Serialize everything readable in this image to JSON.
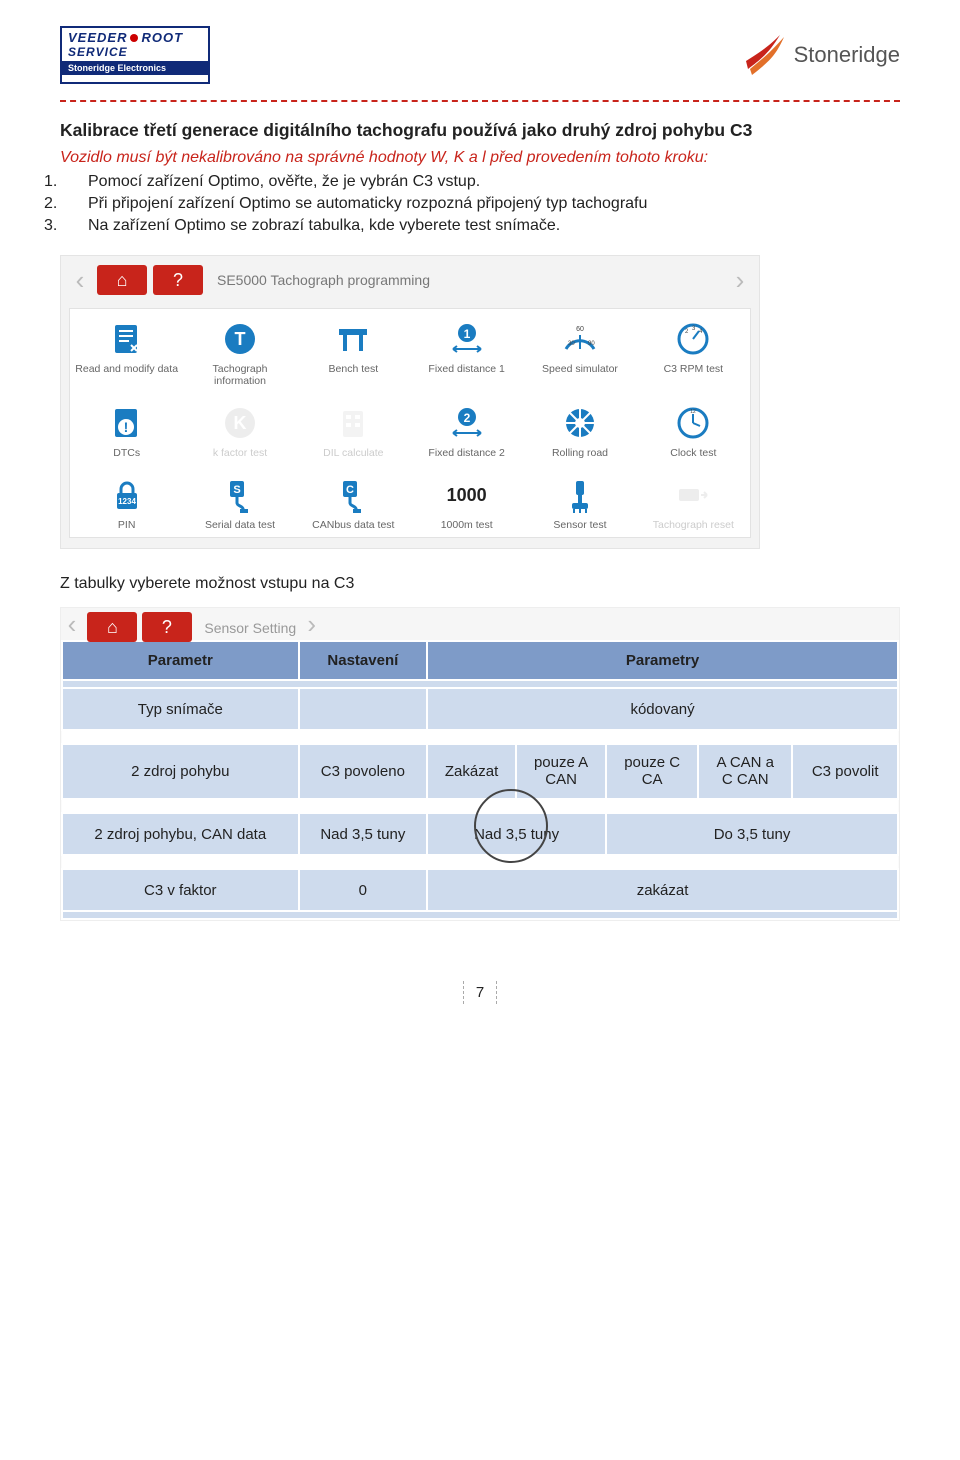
{
  "header": {
    "veeder_name": "VEEDER",
    "veeder_root": "ROOT",
    "veeder_service": "SERVICE",
    "veeder_bar": "Stoneridge Electronics",
    "stoneridge": "Stoneridge"
  },
  "title": "Kalibrace třetí generace digitálního tachografu používá jako druhý zdroj pohybu C3",
  "subtitle": "Vozidlo musí být nekalibrováno na správné hodnoty W, K a l před provedením tohoto kroku:",
  "steps": [
    "Pomocí zařízení Optimo, ověřte, že je vybrán C3 vstup.",
    "Při připojení zařízení Optimo se automaticky rozpozná připojený typ tachografu",
    "Na zařízení Optimo se zobrazí  tabulka, kde vyberete test snímače."
  ],
  "optimo": {
    "crumb": "SE5000 Tachograph programming",
    "icons": {
      "home": "⌂",
      "help": "?",
      "back": "‹",
      "fwd": "›"
    },
    "items": [
      {
        "label": "Read and modify data",
        "icon": "doc-edit"
      },
      {
        "label": "Tachograph information",
        "icon": "circle-t"
      },
      {
        "label": "Bench test",
        "icon": "bench"
      },
      {
        "label": "Fixed distance 1",
        "icon": "fd-1"
      },
      {
        "label": "Speed simulator",
        "icon": "speedo-60"
      },
      {
        "label": "C3 RPM test",
        "icon": "rpm"
      },
      {
        "label": "DTCs",
        "icon": "doc-warn"
      },
      {
        "label": "k factor test",
        "icon": "circle-k",
        "disabled": true
      },
      {
        "label": "DIL calculate",
        "icon": "pad",
        "disabled": true
      },
      {
        "label": "Fixed distance 2",
        "icon": "fd-2"
      },
      {
        "label": "Rolling road",
        "icon": "wheel"
      },
      {
        "label": "Clock test",
        "icon": "clock"
      },
      {
        "label": "PIN",
        "icon": "lock-pin"
      },
      {
        "label": "Serial data test",
        "icon": "serial-s"
      },
      {
        "label": "CANbus data test",
        "icon": "can-c"
      },
      {
        "label": "1000m test",
        "icon": "num-1000"
      },
      {
        "label": "Sensor test",
        "icon": "sensor"
      },
      {
        "label": "Tachograph reset",
        "icon": "reset",
        "disabled": true
      }
    ]
  },
  "between_text": "Z tabulky vyberete možnost vstupu na C3",
  "sensor_panel": {
    "crumb": "Sensor Setting",
    "headers": [
      "Parametr",
      "Nastavení",
      "Parametry"
    ],
    "rows": [
      {
        "cells": [
          "Typ snímače",
          "",
          "kódovaný"
        ],
        "colspan": [
          1,
          1,
          5
        ]
      },
      {
        "cells": [
          "2 zdroj pohybu",
          "C3 povoleno",
          "Zakázat",
          "pouze A CAN",
          "pouze C CA",
          "A CAN a C CAN",
          "C3 povolit"
        ]
      },
      {
        "cells": [
          "2 zdroj pohybu, CAN data",
          "Nad 3,5 tuny",
          "Nad 3,5 tuny",
          "Do 3,5 tuny"
        ],
        "colspan": [
          1,
          1,
          2,
          3
        ]
      },
      {
        "cells": [
          "C3 v faktor",
          "0",
          "zakázat"
        ],
        "colspan": [
          1,
          1,
          5
        ]
      }
    ]
  },
  "page_number": "7"
}
